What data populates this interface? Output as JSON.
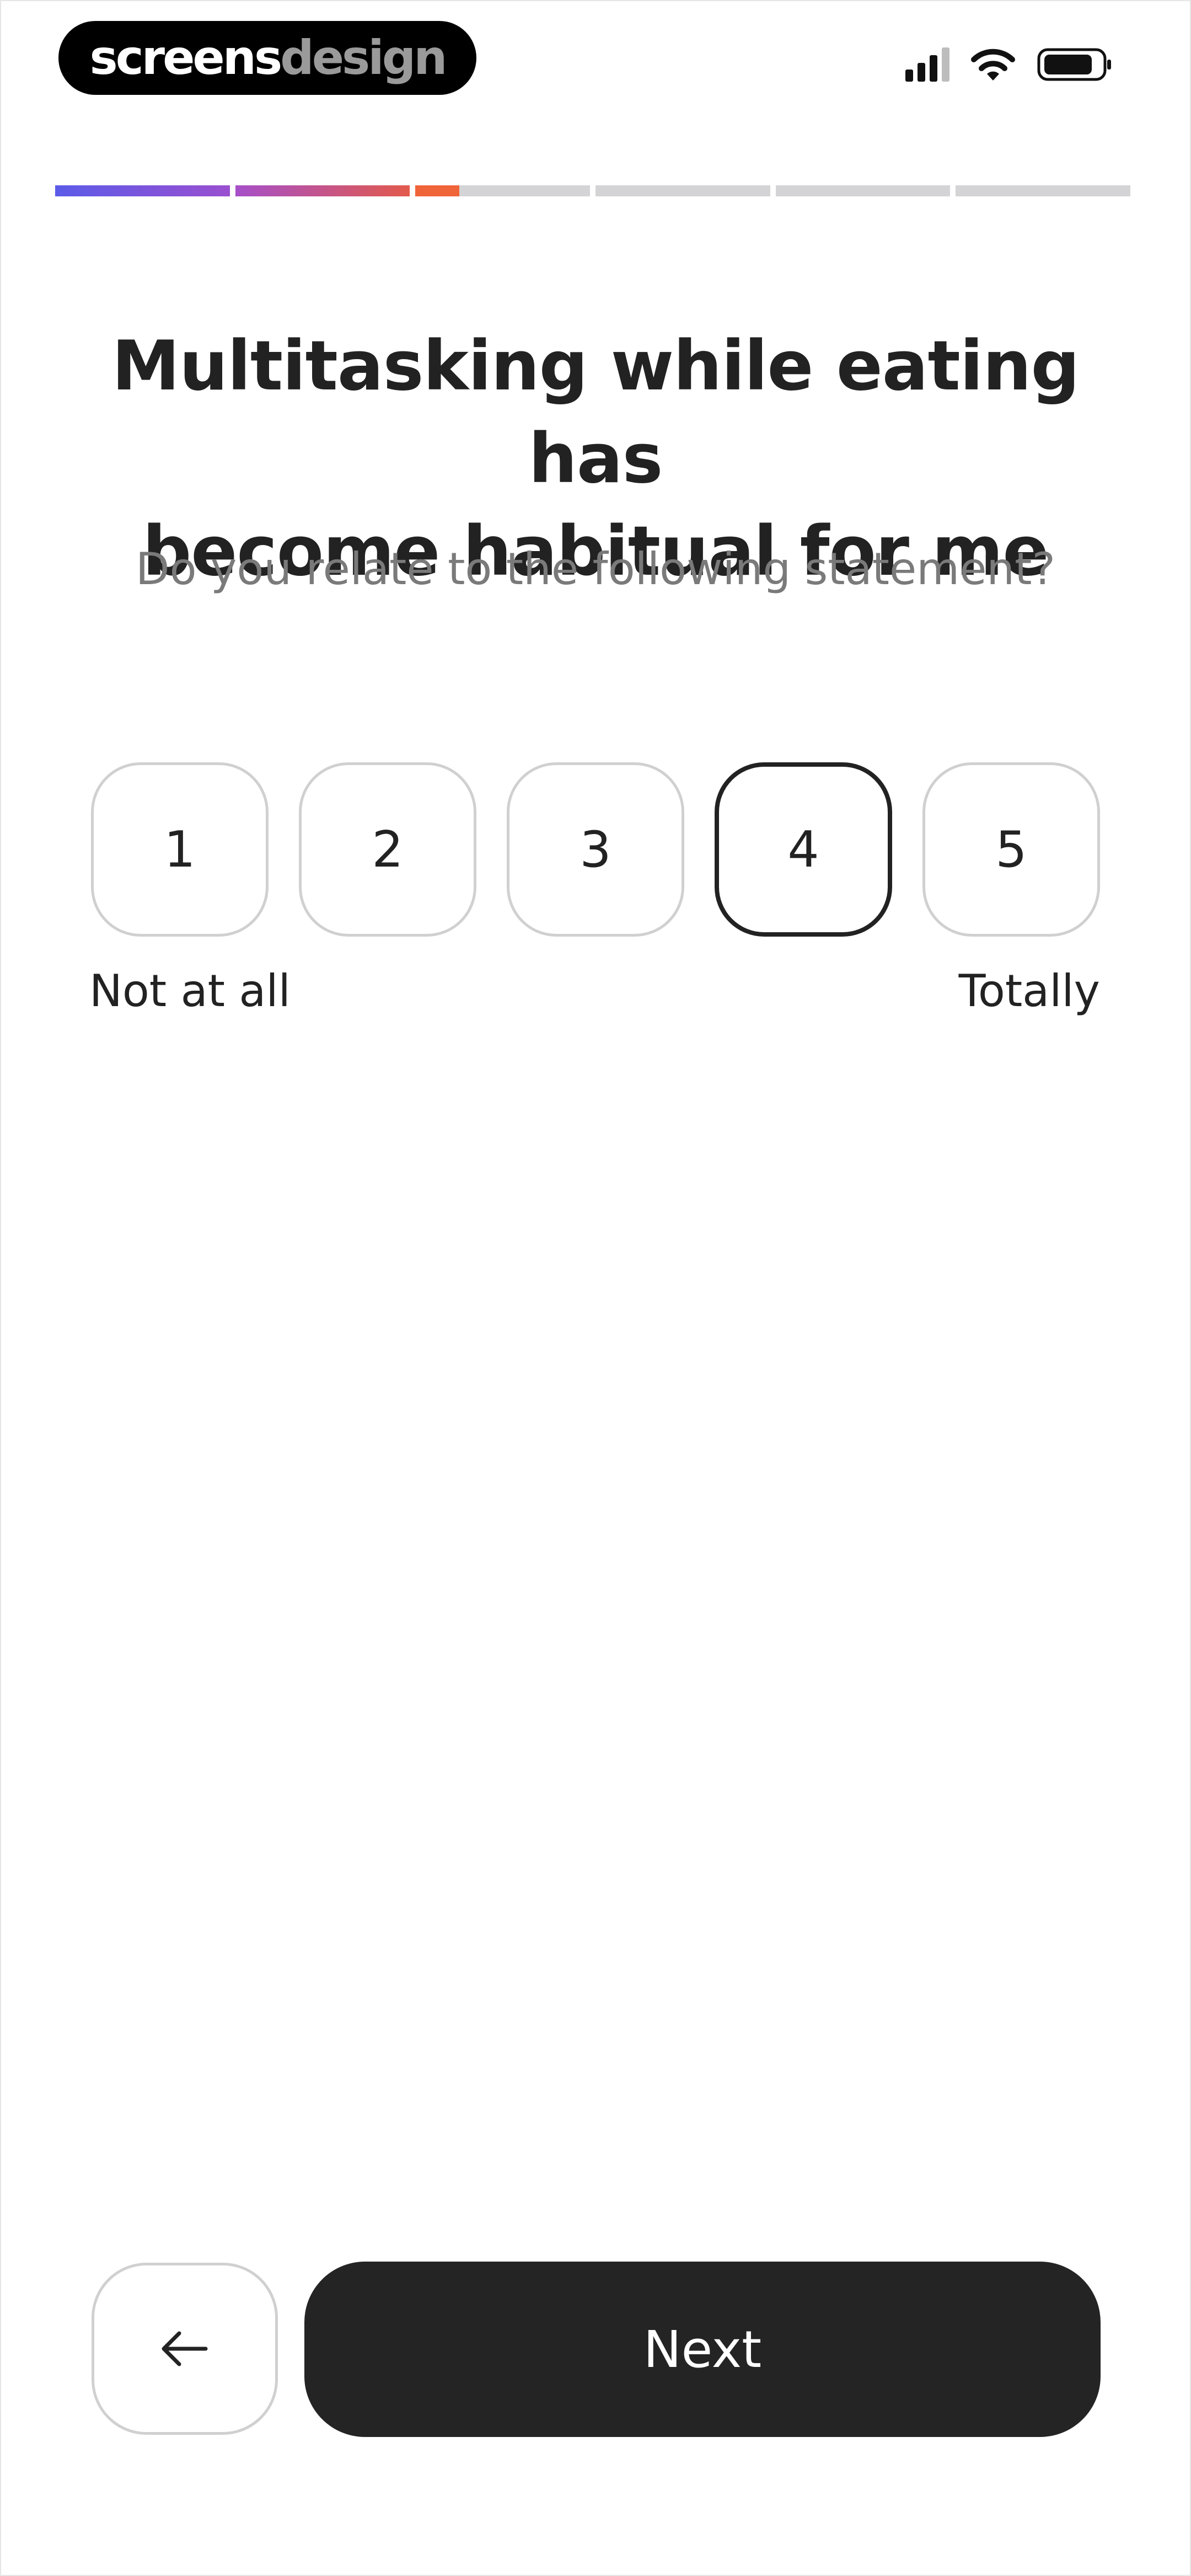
{
  "status_bar": {
    "brand_part1": "screens",
    "brand_part2": "design",
    "icons": [
      "cellular-signal-icon",
      "wifi-icon",
      "battery-icon"
    ]
  },
  "progress": {
    "segments": [
      {
        "fill": 1.0,
        "colors": [
          "#5b5be8",
          "#9a4fd0"
        ]
      },
      {
        "fill": 1.0,
        "colors": [
          "#a64fc9",
          "#e25a4c"
        ]
      },
      {
        "fill": 0.25,
        "colors": [
          "#f0643a",
          "#f0643a"
        ]
      },
      {
        "fill": 0.0,
        "colors": [
          "#d4d4d6",
          "#d4d4d6"
        ]
      },
      {
        "fill": 0.0,
        "colors": [
          "#d4d4d6",
          "#d4d4d6"
        ]
      },
      {
        "fill": 0.0,
        "colors": [
          "#d4d4d6",
          "#d4d4d6"
        ]
      }
    ]
  },
  "question": {
    "title_line1": "Multitasking while eating has",
    "title_line2": "become habitual for me",
    "subtitle": "Do you relate to the following statement?"
  },
  "rating": {
    "options": [
      "1",
      "2",
      "3",
      "4",
      "5"
    ],
    "selected": "4",
    "low_label": "Not at all",
    "high_label": "Totally"
  },
  "footer": {
    "back_icon": "arrow-left-icon",
    "next_label": "Next"
  },
  "colors": {
    "text": "#222222",
    "muted": "#7a7a7a",
    "button_dark": "#242424",
    "border": "#d0d0d0"
  }
}
